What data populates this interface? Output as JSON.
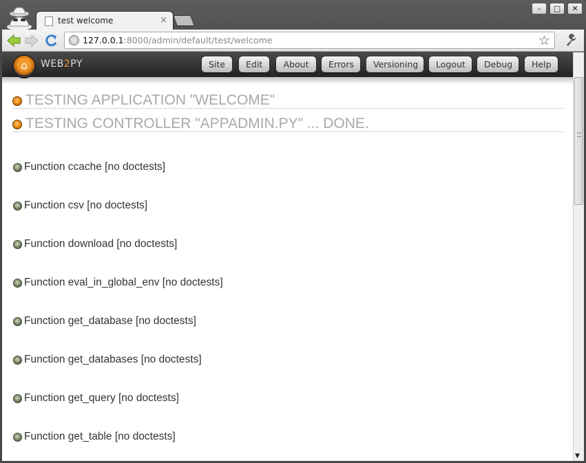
{
  "browser": {
    "tab_title": "test welcome",
    "tab_close": "×",
    "url_host": "127.0.0.1",
    "url_rest": ":8000/admin/default/test/welcome",
    "window_buttons": [
      "–",
      "□",
      "✕"
    ]
  },
  "web2py": {
    "logo_pre": "WEB",
    "logo_two": "2",
    "logo_post": "PY",
    "menu": [
      "Site",
      "Edit",
      "About",
      "Errors",
      "Versioning",
      "Logout",
      "Debug",
      "Help"
    ]
  },
  "content": {
    "headings": [
      "TESTING APPLICATION \"WELCOME\"",
      "TESTING CONTROLLER \"APPADMIN.PY\" ... DONE."
    ],
    "functions": [
      "Function ccache [no doctests]",
      "Function csv [no doctests]",
      "Function download [no doctests]",
      "Function eval_in_global_env [no doctests]",
      "Function get_database [no doctests]",
      "Function get_databases [no doctests]",
      "Function get_query [no doctests]",
      "Function get_table [no doctests]"
    ]
  },
  "colors": {
    "accent": "#f29a2c",
    "heading_text": "#a9a9a9",
    "body_text": "#333333"
  }
}
